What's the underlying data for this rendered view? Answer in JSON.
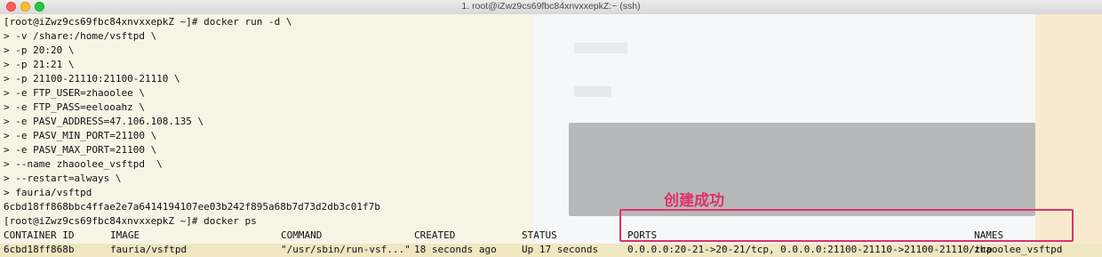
{
  "window": {
    "title": "1. root@iZwz9cs69fbc84xnvxxepkZ:~ (ssh)"
  },
  "terminal": {
    "lines": [
      "[root@iZwz9cs69fbc84xnvxxepkZ ~]# docker run -d \\",
      "> -v /share:/home/vsftpd \\",
      "> -p 20:20 \\",
      "> -p 21:21 \\",
      "> -p 21100-21110:21100-21110 \\",
      "> -e FTP_USER=zhaoolee \\",
      "> -e FTP_PASS=eelooahz \\",
      "> -e PASV_ADDRESS=47.106.108.135 \\",
      "> -e PASV_MIN_PORT=21100 \\",
      "> -e PASV_MAX_PORT=21100 \\",
      "> --name zhaoolee_vsftpd  \\",
      "> --restart=always \\",
      "> fauria/vsftpd",
      "6cbd18ff868bbc4ffae2e7a6414194107ee03b242f895a68b7d73d2db3c01f7b",
      "[root@iZwz9cs69fbc84xnvxxepkZ ~]# docker ps"
    ],
    "ps_table": {
      "headers": {
        "container_id": "CONTAINER ID",
        "image": "IMAGE",
        "command": "COMMAND",
        "created": "CREATED",
        "status": "STATUS",
        "ports": "PORTS",
        "names": "NAMES"
      },
      "row": {
        "container_id": "6cbd18ff868b",
        "image": "fauria/vsftpd",
        "command": "\"/usr/sbin/run-vsf...\"",
        "created": "18 seconds ago",
        "status": "Up 17 seconds",
        "ports": "0.0.0.0:20-21->20-21/tcp, 0.0.0.0:21100-21110->21100-21110/tcp",
        "names": "zhaoolee_vsftpd"
      }
    }
  },
  "annotation": {
    "text": "创建成功",
    "color": "#e0306a"
  }
}
